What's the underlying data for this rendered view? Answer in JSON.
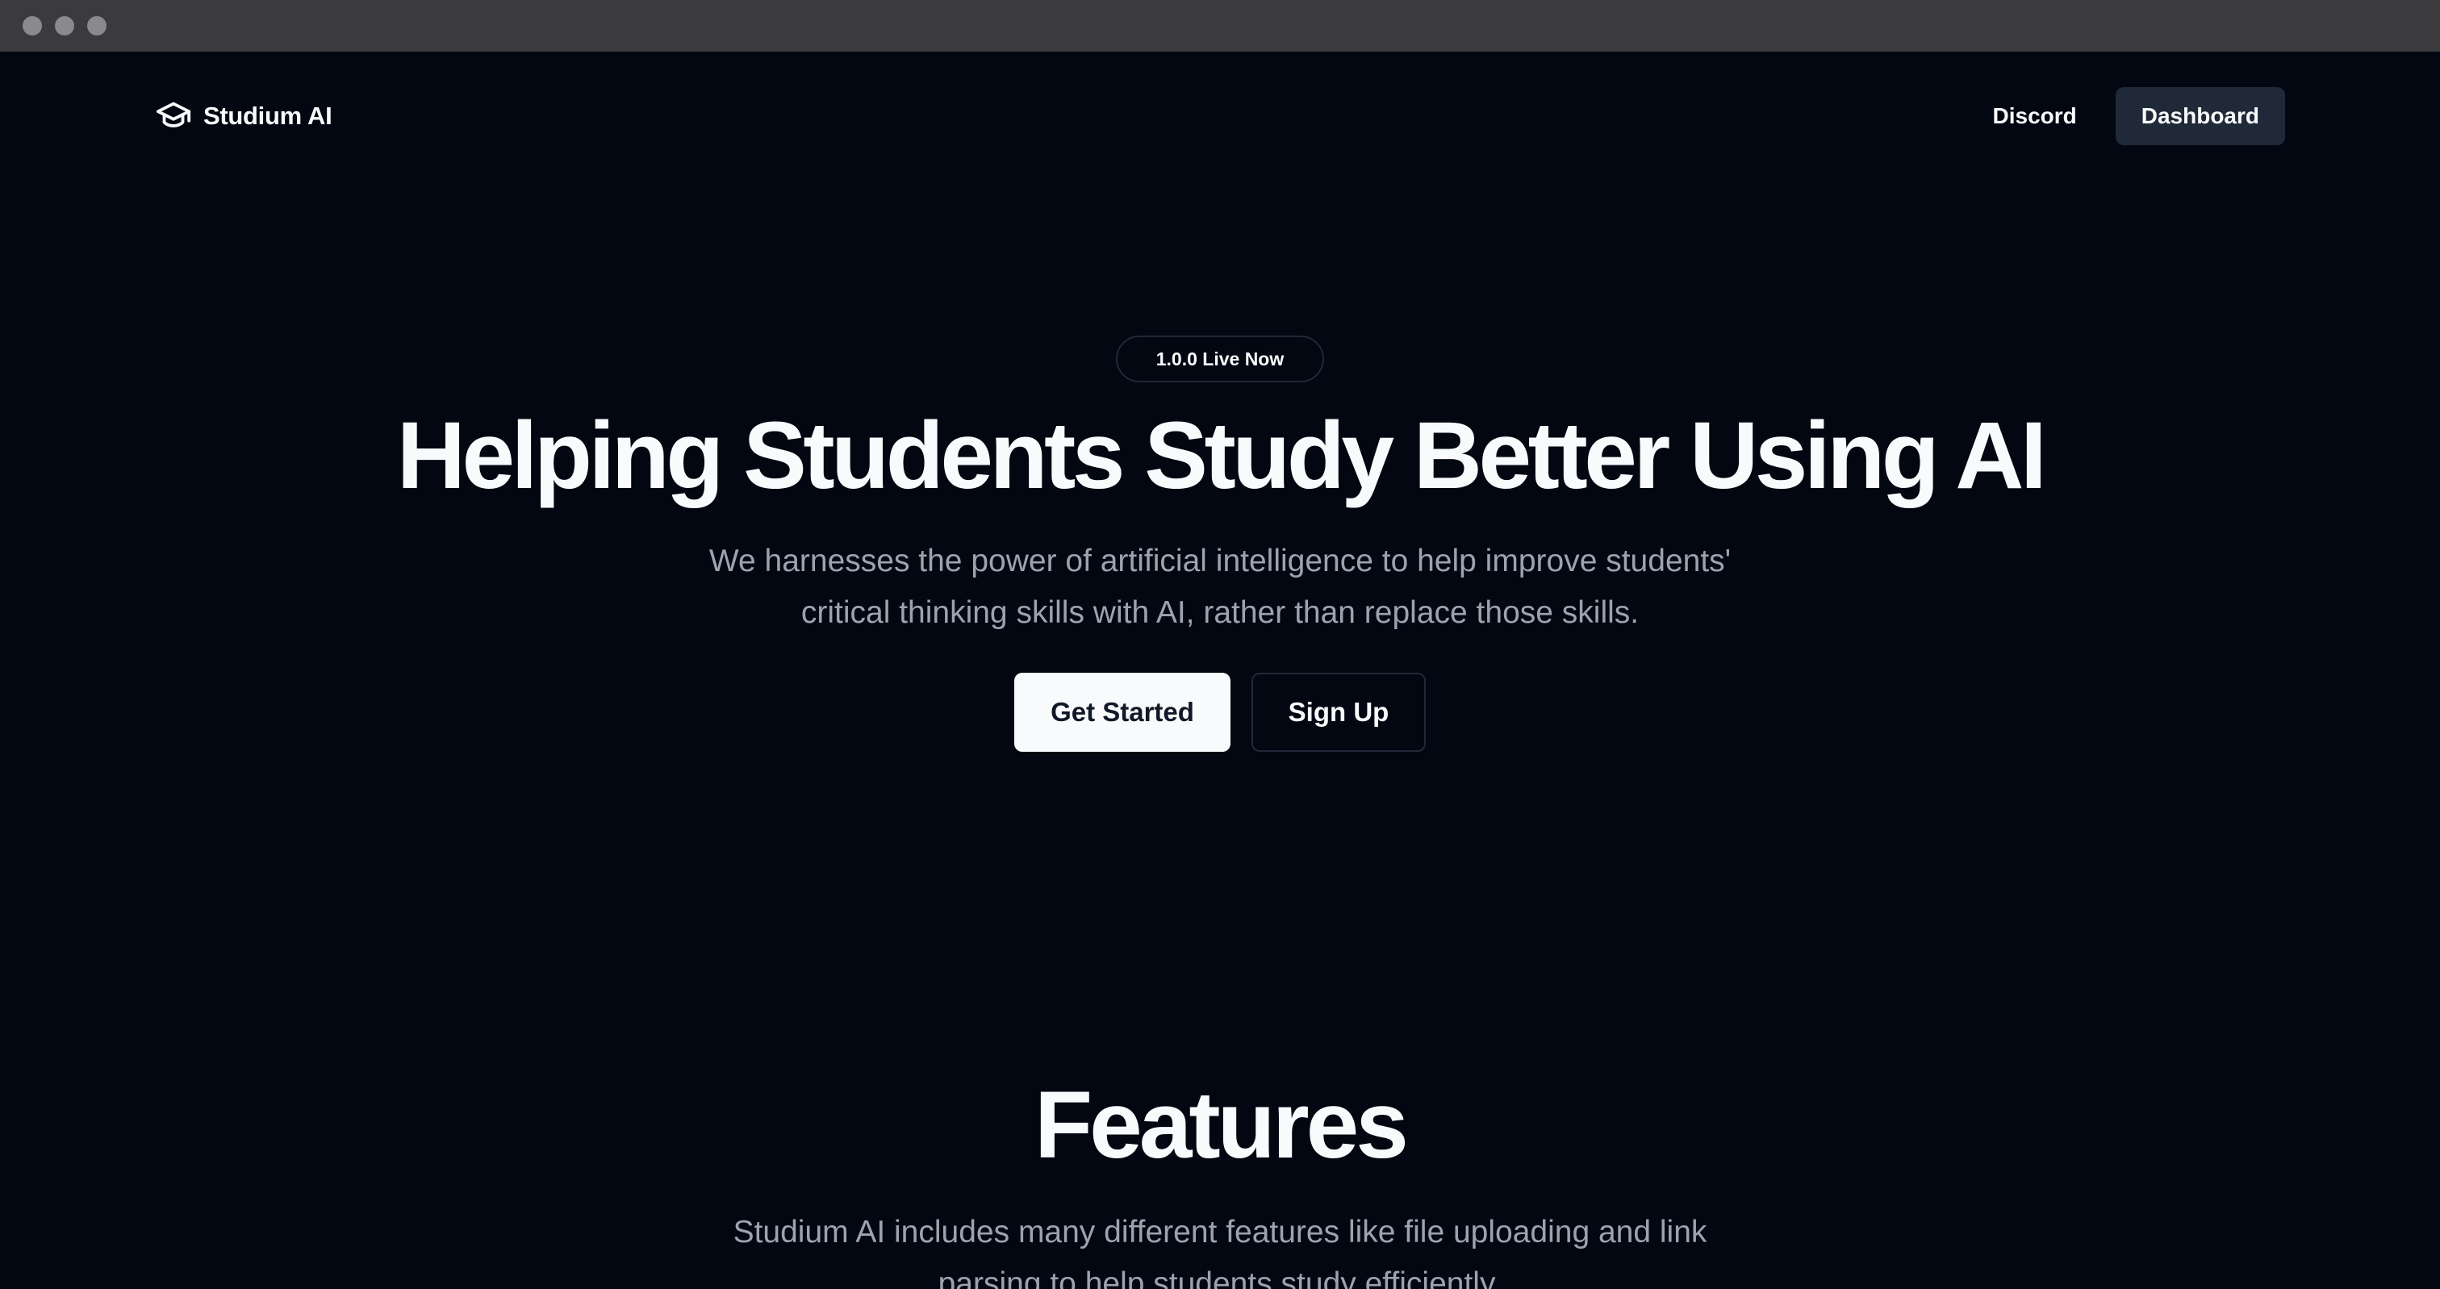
{
  "nav": {
    "brand_name": "Studium AI",
    "brand_icon": "graduation-cap-icon",
    "discord_label": "Discord",
    "dashboard_label": "Dashboard"
  },
  "hero": {
    "badge": "1.0.0 Live Now",
    "title": "Helping Students Study Better Using AI",
    "subtitle": "We harnesses the power of artificial intelligence to help improve students' critical thinking skills with AI, rather than replace those skills.",
    "primary_cta": "Get Started",
    "secondary_cta": "Sign Up"
  },
  "features": {
    "title": "Features",
    "subtitle": "Studium AI includes many different features like file uploading and link parsing to help students study efficiently."
  },
  "colors": {
    "background": "#030712",
    "foreground": "#f9fafb",
    "muted": "#9ca3af",
    "button_dark": "#1f2937",
    "chrome": "#3b3b3d"
  }
}
